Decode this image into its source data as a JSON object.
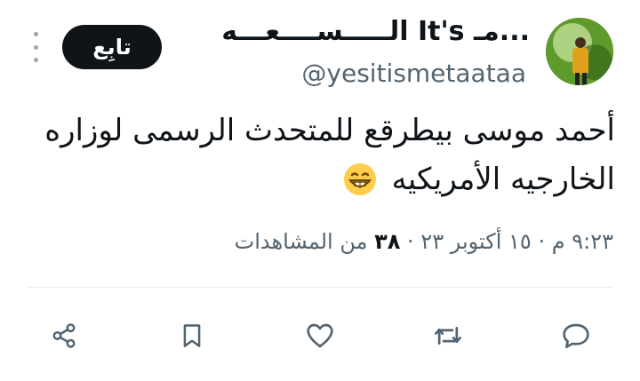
{
  "user": {
    "display_name": "...مـ It's ﺍﻟـــــﺴــــﻌـــﻪ",
    "handle": "@yesitismetaataa",
    "avatar": "avatar-photo"
  },
  "follow_button": {
    "label": "تابِع"
  },
  "tweet": {
    "text": "أحمد موسى بيطرقع للمتحدث الرسمى لوزاره الخارجيه الأمريكيه",
    "emoji": "grinning-face-emoji"
  },
  "meta": {
    "time": "٩:٢٣ م",
    "separator": "·",
    "date": "١٥ أكتوبر ٢٣",
    "views_count": "٣٨",
    "views_label": "من المشاهدات"
  },
  "actions": {
    "reply": "reply-icon",
    "retweet": "retweet-icon",
    "like": "like-icon",
    "bookmark": "bookmark-icon",
    "share": "share-icon"
  },
  "colors": {
    "text": "#0f1419",
    "secondary": "#536471",
    "button_bg": "#0f1419",
    "emoji": "#ffcc4d"
  }
}
